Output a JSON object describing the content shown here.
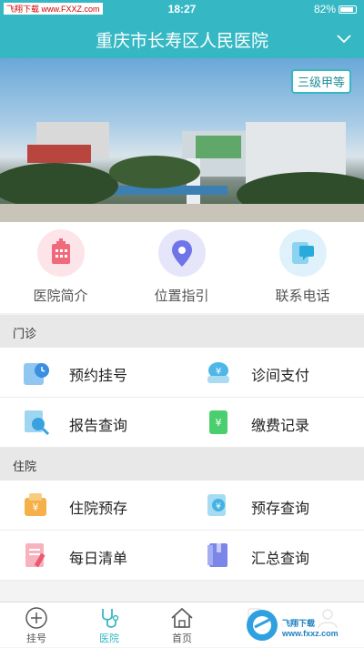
{
  "status_bar": {
    "carrier": "飞翔下载 www.FXXZ.com",
    "time": "18:27",
    "battery": "82%"
  },
  "header": {
    "title": "重庆市长寿区人民医院"
  },
  "banner": {
    "badge": "三级甲等"
  },
  "quick_actions": [
    {
      "label": "医院简介",
      "icon": "hospital-building-icon"
    },
    {
      "label": "位置指引",
      "icon": "location-pin-icon"
    },
    {
      "label": "联系电话",
      "icon": "phone-chat-icon"
    }
  ],
  "outpatient": {
    "title": "门诊",
    "items": [
      {
        "label": "预约挂号",
        "icon": "appointment-clock-icon"
      },
      {
        "label": "诊间支付",
        "icon": "yen-payment-icon"
      },
      {
        "label": "报告查询",
        "icon": "report-search-icon"
      },
      {
        "label": "缴费记录",
        "icon": "payment-record-icon"
      }
    ]
  },
  "inpatient": {
    "title": "住院",
    "items": [
      {
        "label": "住院预存",
        "icon": "deposit-icon"
      },
      {
        "label": "预存查询",
        "icon": "deposit-query-icon"
      },
      {
        "label": "每日清单",
        "icon": "daily-list-icon"
      },
      {
        "label": "汇总查询",
        "icon": "summary-query-icon"
      }
    ]
  },
  "tabs": [
    {
      "label": "挂号",
      "icon": "plus-circle-icon",
      "active": false
    },
    {
      "label": "医院",
      "icon": "stethoscope-icon",
      "active": true
    },
    {
      "label": "首页",
      "icon": "home-icon",
      "active": false
    },
    {
      "label": "",
      "icon": "bookmark-icon",
      "active": false
    },
    {
      "label": "",
      "icon": "profile-icon",
      "active": false
    }
  ],
  "watermark": "飞翔下载 www.fxxz.com",
  "colors": {
    "primary": "#35b8c4",
    "section_bg": "#e8e8e8"
  }
}
